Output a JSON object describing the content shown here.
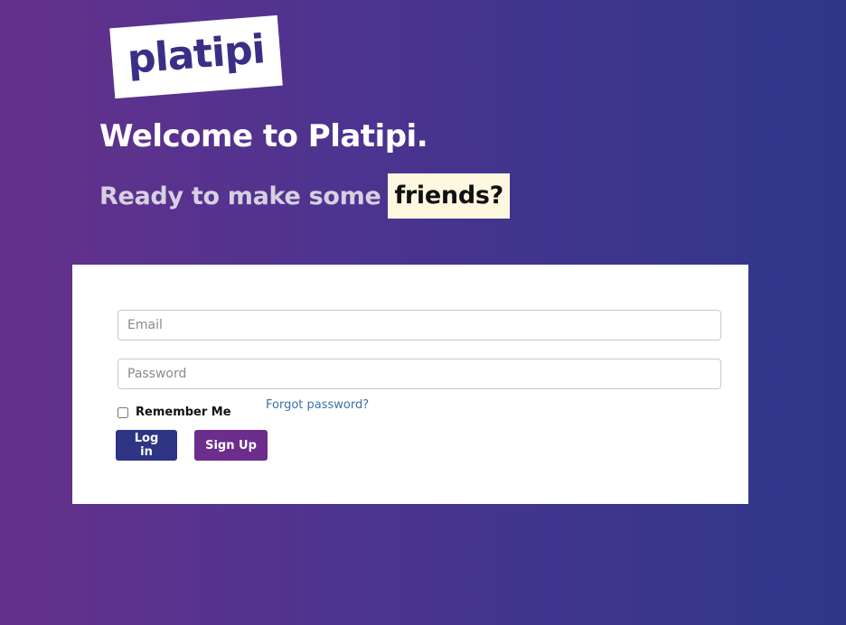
{
  "brand": {
    "logo_text": "platipi"
  },
  "header": {
    "welcome": "Welcome to Platipi.",
    "tagline": "Ready to make some",
    "highlight_word": "friends?"
  },
  "login_form": {
    "email_placeholder": "Email",
    "email_value": "",
    "password_placeholder": "Password",
    "password_value": "",
    "remember_label": "Remember Me",
    "remember_checked": false,
    "forgot_link": "Forgot password?",
    "login_label": "Log in",
    "signup_label": "Sign Up"
  },
  "colors": {
    "gradient_start": "#65318b",
    "gradient_end": "#2f3789",
    "login_button": "#2e3585",
    "signup_button": "#6d2d8d",
    "link": "#3b73a8",
    "highlight_bg": "#fff8e0"
  }
}
